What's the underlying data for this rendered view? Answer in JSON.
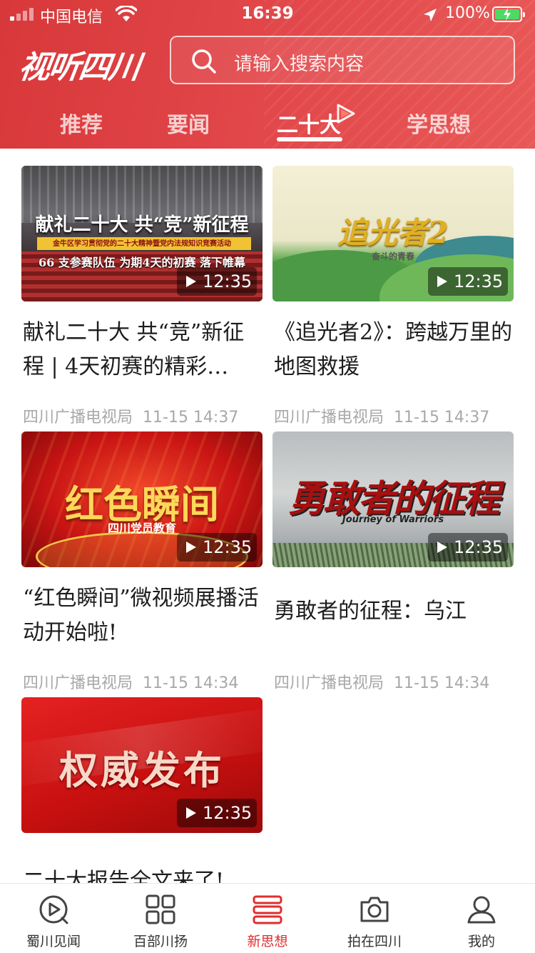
{
  "status_bar": {
    "carrier": "中国电信",
    "time": "16:39",
    "battery_percent": "100%"
  },
  "header": {
    "logo_text": "视听四川",
    "search_placeholder": "请输入搜索内容",
    "tabs": [
      {
        "label": "推荐",
        "active": false
      },
      {
        "label": "要闻",
        "active": false
      },
      {
        "label": "二十大",
        "active": true
      },
      {
        "label": "学思想",
        "active": false
      }
    ]
  },
  "cards": [
    {
      "thumb_text": "献礼二十大 共“竞”新征程",
      "thumb_subtext": "金牛区学习贯彻党的二十大精神暨党内法规知识竞赛活动",
      "thumb_subtext2": "66 支参赛队伍 为期4天的初赛 落下帷幕",
      "duration": "12:35",
      "title": "献礼二十大 共“竞”新征程 | 4天初赛的精彩…",
      "source": "四川广播电视局",
      "time": "11-15 14:37"
    },
    {
      "thumb_text": "追光者2",
      "thumb_subtext": "奋斗的青春",
      "duration": "12:35",
      "title": "《追光者2》：跨越万里的地图救援",
      "source": "四川广播电视局",
      "time": "11-15 14:37"
    },
    {
      "thumb_text": "红色瞬间",
      "thumb_subtext": "四川党员教育",
      "duration": "12:35",
      "title": "“红色瞬间”微视频展播活动开始啦!",
      "source": "四川广播电视局",
      "time": "11-15 14:34"
    },
    {
      "thumb_text": "勇敢者的征程",
      "thumb_subtext": "Journey of Warriors",
      "duration": "12:35",
      "title": "勇敢者的征程：乌江",
      "source": "四川广播电视局",
      "time": "11-15 14:34"
    },
    {
      "thumb_text": "权威发布",
      "duration": "12:35"
    }
  ],
  "peek_title": "二十大报告全文来了!",
  "bottom_nav": [
    {
      "label": "蜀川见闻",
      "icon": "play-circle-icon"
    },
    {
      "label": "百部川扬",
      "icon": "grid-icon"
    },
    {
      "label": "新思想",
      "icon": "stack-icon",
      "active": true
    },
    {
      "label": "拍在四川",
      "icon": "camera-icon"
    },
    {
      "label": "我的",
      "icon": "user-icon"
    }
  ],
  "colors": {
    "brand_red": "#e0393b",
    "active_nav": "#e02e2e",
    "meta_gray": "#a8a8a8",
    "battery_green": "#4cd964"
  }
}
